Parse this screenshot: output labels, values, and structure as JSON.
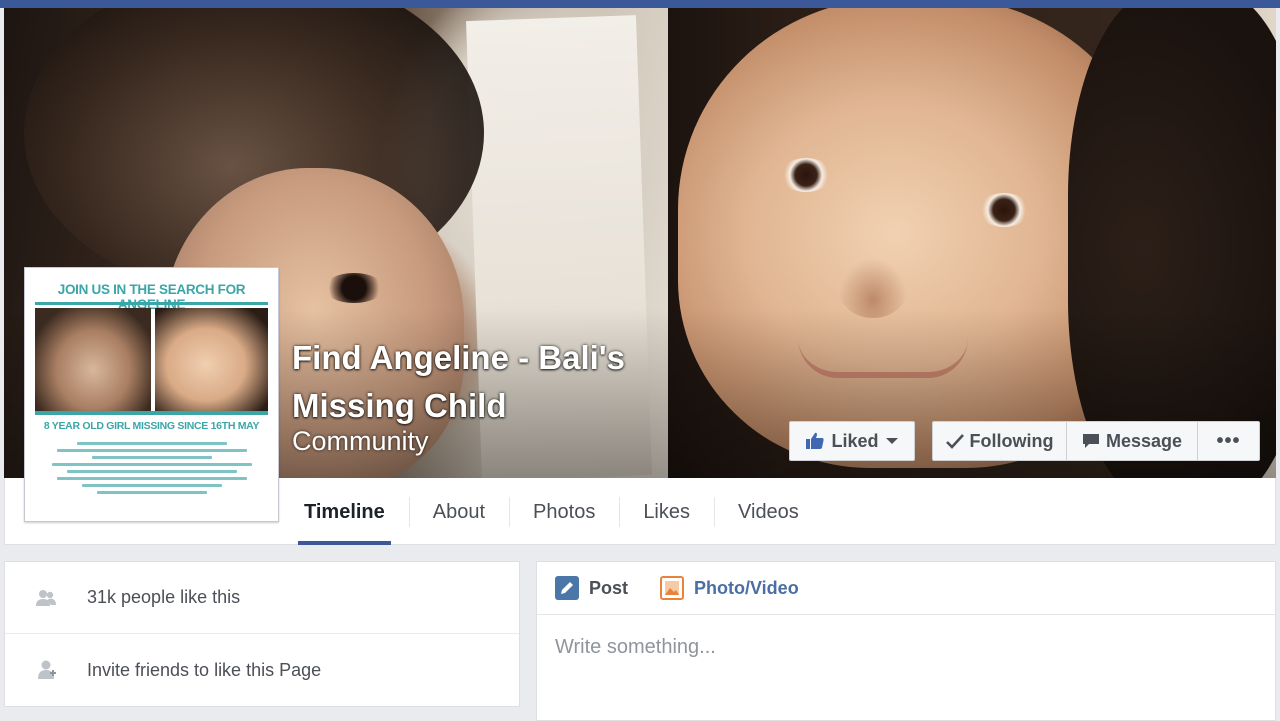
{
  "page": {
    "name": "Find Angeline - Bali's Missing Child",
    "category": "Community"
  },
  "profile_poster": {
    "headline": "JOIN US IN THE SEARCH FOR ANGELINE",
    "subheadline": "8 YEAR OLD GIRL MISSING SINCE 16TH MAY"
  },
  "actions": {
    "liked": "Liked",
    "following": "Following",
    "message": "Message",
    "more": "•••"
  },
  "tabs": [
    "Timeline",
    "About",
    "Photos",
    "Likes",
    "Videos"
  ],
  "active_tab": "Timeline",
  "sidebar": {
    "likes_count": "31k people like this",
    "invite": "Invite friends to like this Page"
  },
  "composer": {
    "post_label": "Post",
    "photo_label": "Photo/Video",
    "placeholder": "Write something..."
  },
  "colors": {
    "brand": "#3b5998",
    "poster_accent": "#3aa6a8",
    "post_icon": "#4a76a8",
    "photo_icon": "#e9823a"
  }
}
